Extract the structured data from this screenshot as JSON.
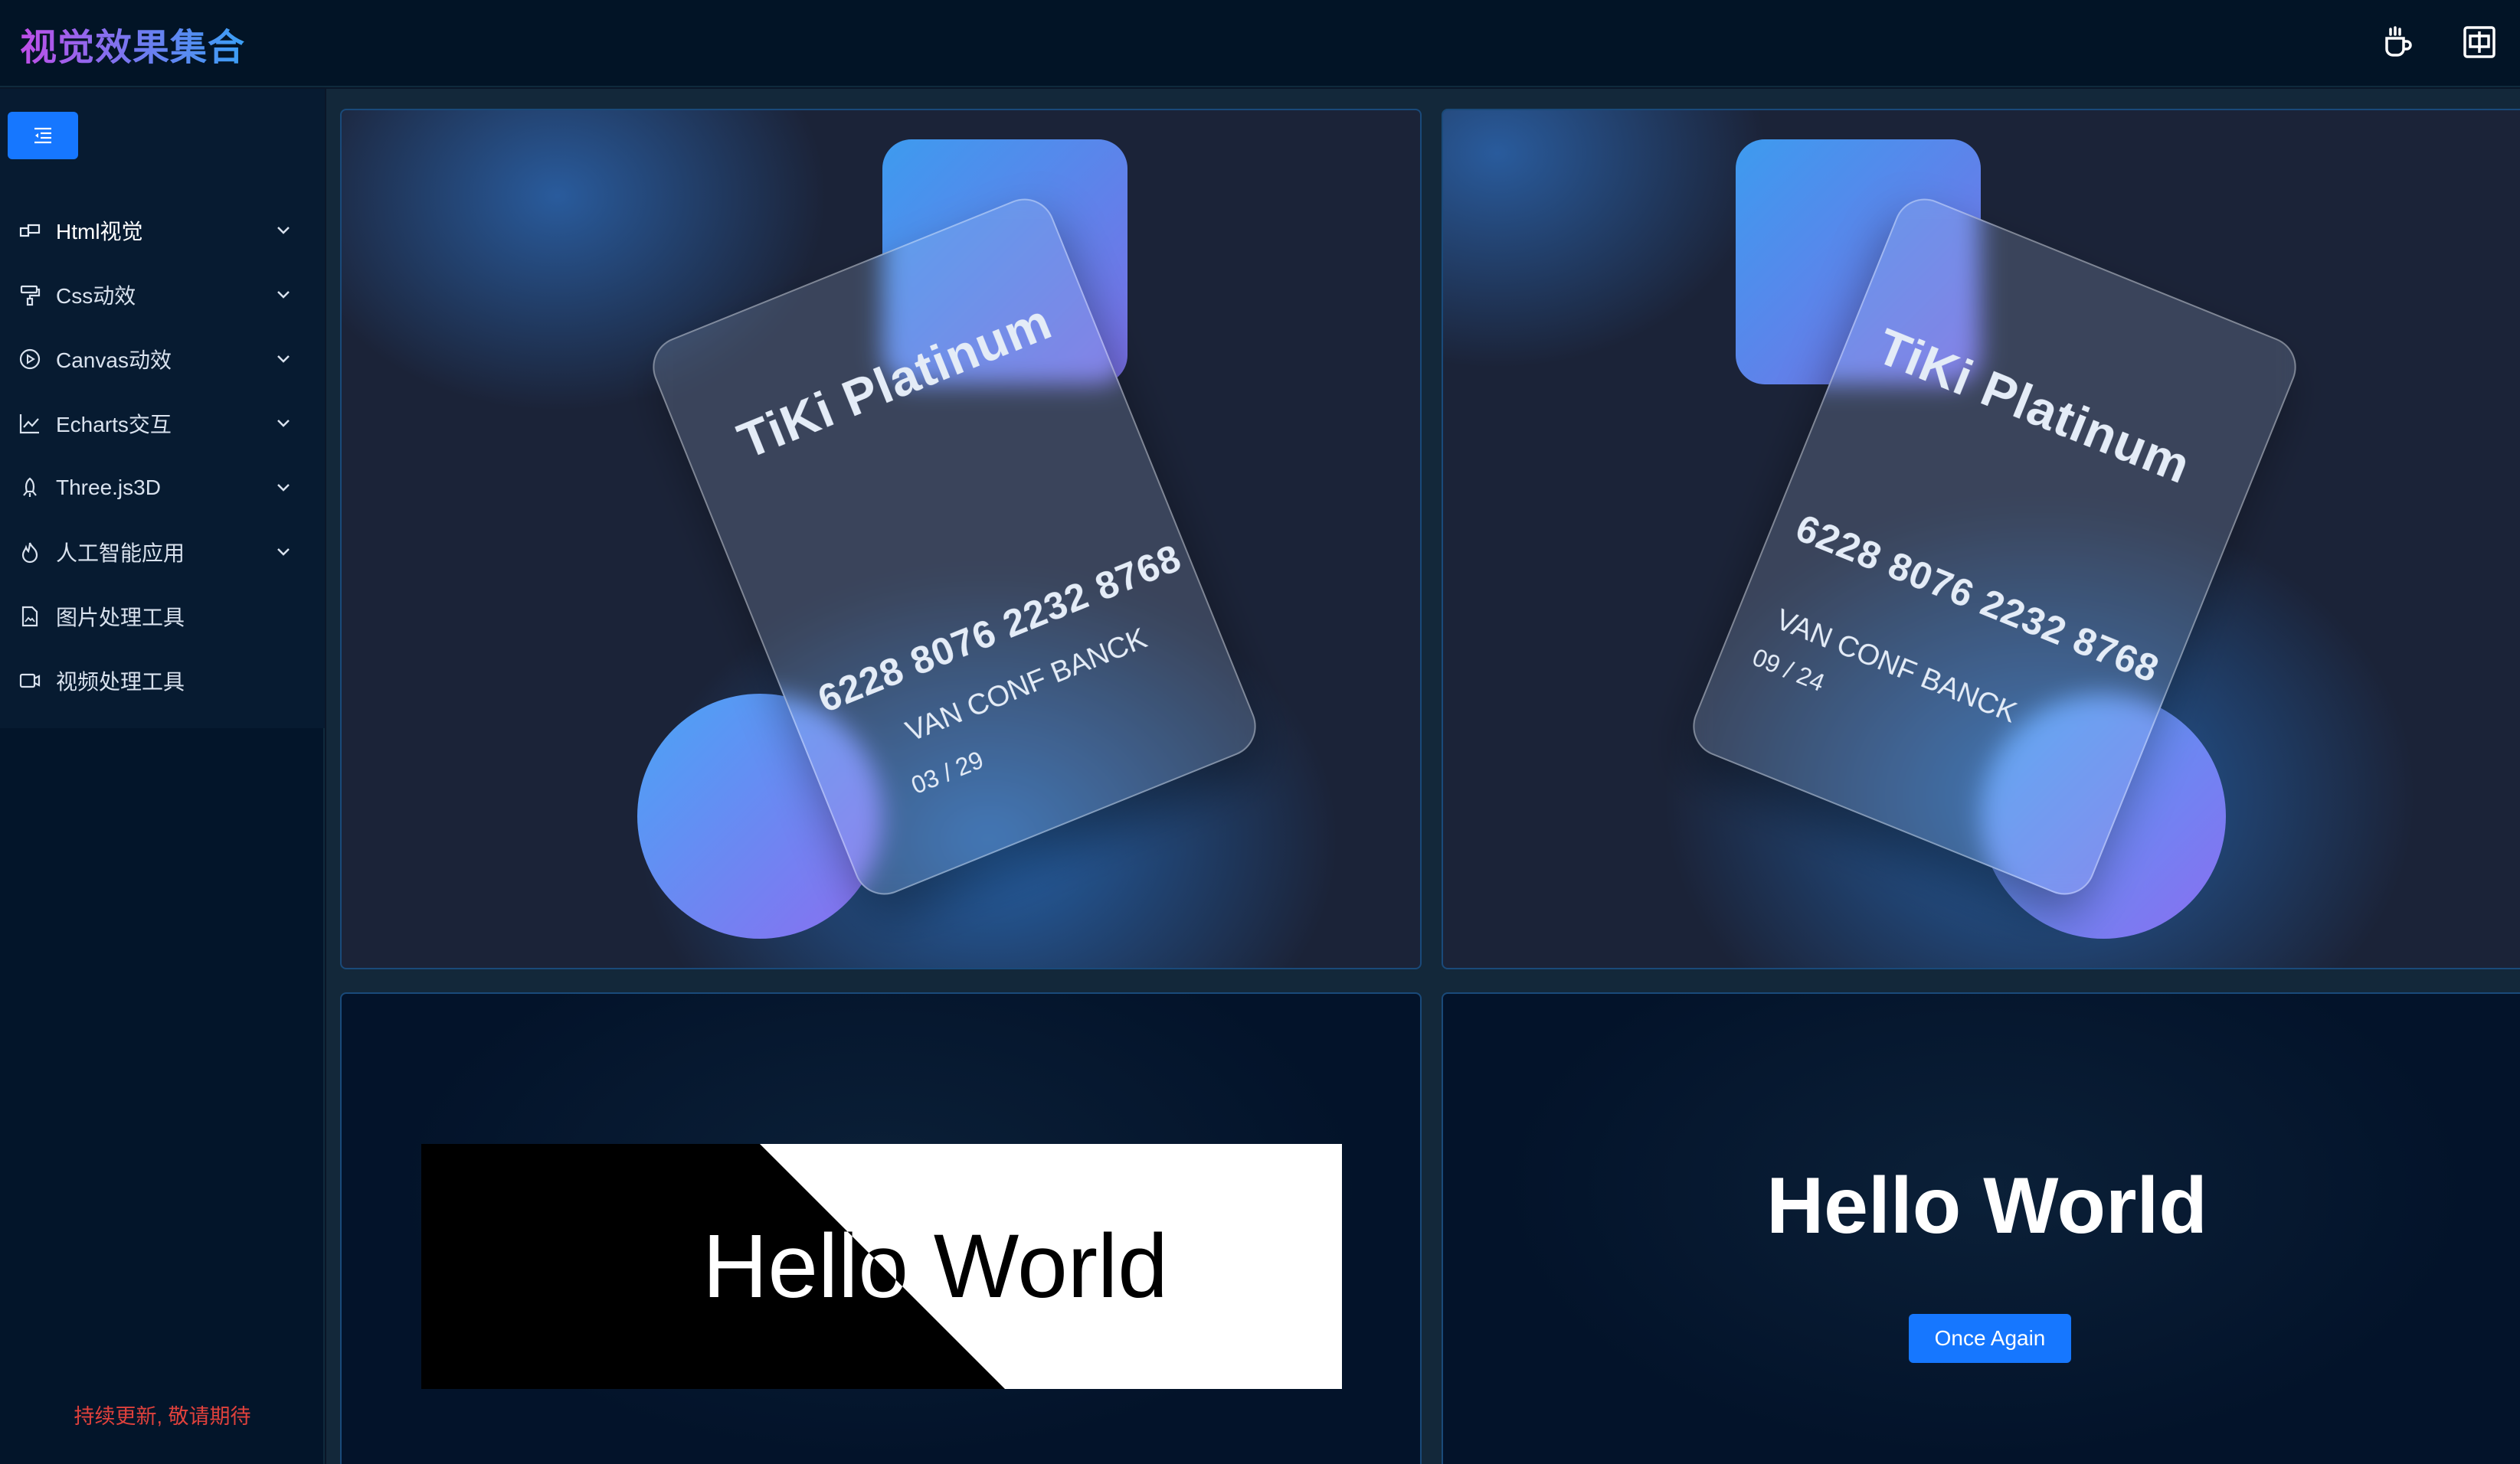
{
  "header": {
    "title": "视觉效果集合",
    "icons": [
      "coffee-icon",
      "translate-icon"
    ]
  },
  "sidebar": {
    "collapse_icon": "menu-fold-icon",
    "items": [
      {
        "label": "Html视觉",
        "icon": "block-icon",
        "has_submenu": true,
        "active": true
      },
      {
        "label": "Css动效",
        "icon": "paint-roller-icon",
        "has_submenu": true
      },
      {
        "label": "Canvas动效",
        "icon": "play-circle-icon",
        "has_submenu": true
      },
      {
        "label": "Echarts交互",
        "icon": "line-chart-icon",
        "has_submenu": true
      },
      {
        "label": "Three.js3D",
        "icon": "rocket-icon",
        "has_submenu": true
      },
      {
        "label": "人工智能应用",
        "icon": "fire-icon",
        "has_submenu": true
      },
      {
        "label": "图片处理工具",
        "icon": "file-image-icon",
        "has_submenu": false
      },
      {
        "label": "视频处理工具",
        "icon": "video-camera-icon",
        "has_submenu": false
      }
    ],
    "footer": "持续更新, 敬请期待"
  },
  "cards": [
    {
      "title": "TiKi Platinum",
      "number": "6228 8076 2232 8768",
      "bank": "VAN CONF BANCK",
      "date": "03 / 29"
    },
    {
      "title": "TiKi Platinum",
      "number": "6228 8076 2232 8768",
      "bank": "VAN CONF BANCK",
      "date": "09 / 24"
    }
  ],
  "demos": {
    "split_text": "Hello World",
    "reveal_text": "Hello World",
    "again_label": "Once Again"
  },
  "colors": {
    "accent": "#1677ff",
    "footer_text": "#e0413c",
    "topbar": "#021426"
  }
}
